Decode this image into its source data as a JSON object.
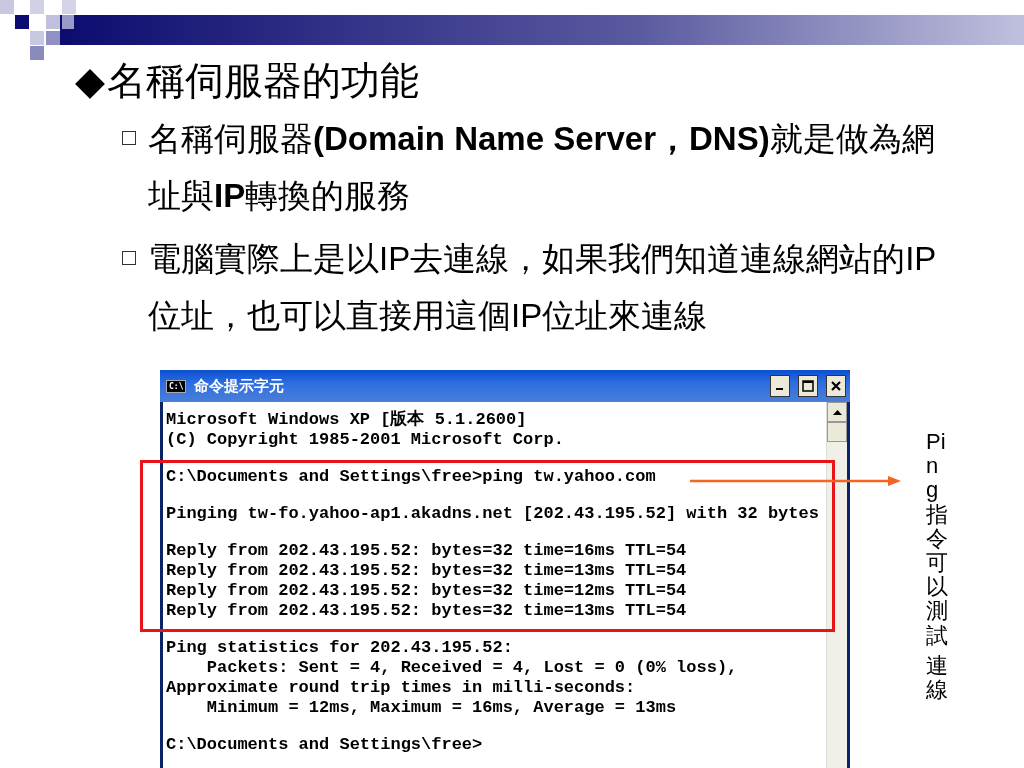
{
  "slide": {
    "title_marker": "◆",
    "title": "名稱伺服器的功能",
    "bullets": [
      {
        "text": "名稱伺服器**(Domain Name Server，DNS)**就是做為網址與**IP**轉換的服務"
      },
      {
        "text": "電腦實際上是以IP去連線，如果我們知道連線網站的IP位址，也可以直接用這個IP位址來連線"
      }
    ]
  },
  "window": {
    "title": "命令提示字元",
    "icon_text": "C:\\",
    "blocks": [
      [
        "Microsoft Windows XP [版本 5.1.2600]",
        "(C) Copyright 1985-2001 Microsoft Corp."
      ],
      [
        "C:\\Documents and Settings\\free>ping tw.yahoo.com"
      ],
      [
        "Pinging tw-fo.yahoo-ap1.akadns.net [202.43.195.52] with 32 bytes"
      ],
      [
        "Reply from 202.43.195.52: bytes=32 time=16ms TTL=54",
        "Reply from 202.43.195.52: bytes=32 time=13ms TTL=54",
        "Reply from 202.43.195.52: bytes=32 time=12ms TTL=54",
        "Reply from 202.43.195.52: bytes=32 time=13ms TTL=54"
      ],
      [
        "Ping statistics for 202.43.195.52:",
        "    Packets: Sent = 4, Received = 4, Lost = 0 (0% loss),",
        "Approximate round trip times in milli-seconds:",
        "    Minimum = 12ms, Maximum = 16ms, Average = 13ms"
      ],
      [
        "C:\\Documents and Settings\\free>"
      ]
    ]
  },
  "callout": {
    "lines": [
      "Ping指令可以測試",
      "連線"
    ]
  }
}
